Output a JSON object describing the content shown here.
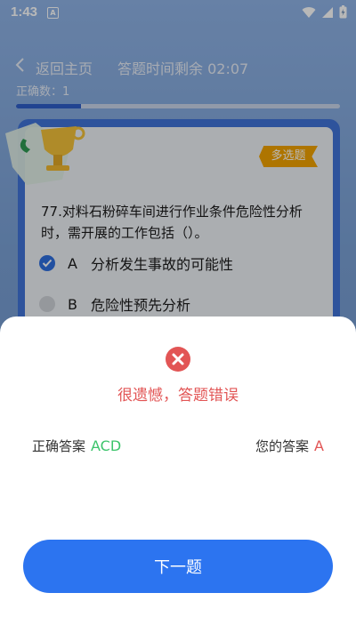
{
  "status_bar": {
    "time": "1:43",
    "notification_letter": "A"
  },
  "header": {
    "back_label": "返回主页",
    "timer_text": "答题时间剩余 02:07",
    "correct_count": "正确数：1",
    "progress_fraction": 0.2
  },
  "question": {
    "type_badge": "多选题",
    "text": "77.对料石粉碎车间进行作业条件危险性分析时，需开展的工作包括（）。",
    "options": [
      {
        "letter": "A",
        "text": "分析发生事故的可能性",
        "checked": true
      },
      {
        "letter": "B",
        "text": "危险性预先分析",
        "checked": false
      }
    ]
  },
  "result_sheet": {
    "title": "很遗憾，答题错误",
    "correct_label": "正确答案",
    "correct_value": "ACD",
    "your_label": "您的答案",
    "your_value": "A",
    "next_button": "下一题"
  },
  "colors": {
    "accent": "#2c74f0",
    "error": "#e25555",
    "success": "#3cc46b",
    "badge": "#f2a300"
  }
}
